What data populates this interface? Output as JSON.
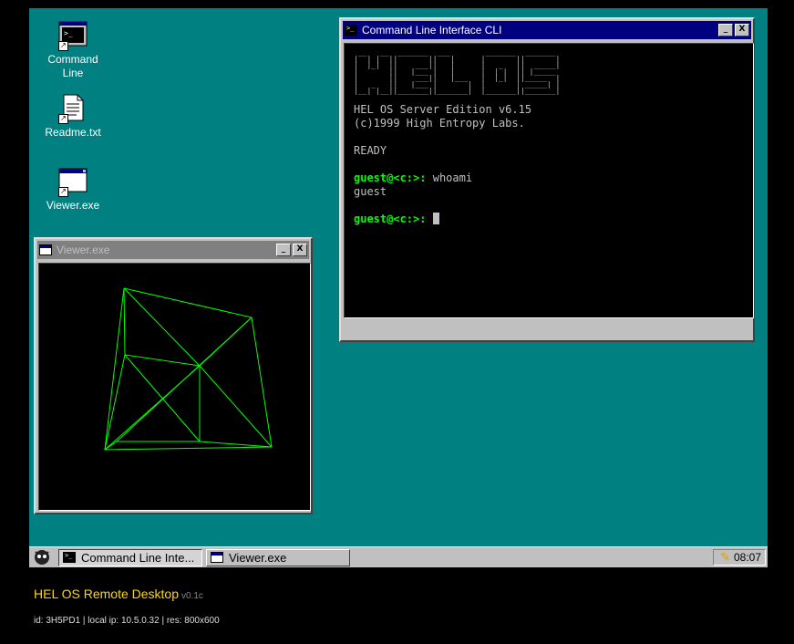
{
  "desktop": {
    "icons": [
      {
        "label": "Command\nLine",
        "icon": "terminal-icon"
      },
      {
        "label": "Readme.txt",
        "icon": "document-icon"
      },
      {
        "label": "Viewer.exe",
        "icon": "window-icon"
      }
    ],
    "background_color": "#008080"
  },
  "cli_window": {
    "title": "Command Line Interface CLI",
    "ascii_banner": " __   __  _______  ___        _______  _______ \n|  | |  ||       ||   |      |       ||       |\n|  |_|  ||    ___||   |      |   _   ||  _____|\n|       ||   |___ |   |      |  | |  || |_____ \n|       ||    ___||   |___   |  |_|  ||_____  |\n|   _   ||   |___ |       |  |       | _____| |\n|__| |__||_______||_______|  |_______||_______|",
    "lines": [
      "HEL OS Server Edition v6.15",
      "(c)1999 High Entropy Labs.",
      "",
      "READY"
    ],
    "prompt": "guest@<c:>:",
    "command": "whoami",
    "output": "guest",
    "prompt2": "guest@<c:>:",
    "minimize": "_",
    "close": "X"
  },
  "viewer_window": {
    "title": "Viewer.exe",
    "minimize": "_",
    "close": "X",
    "line_color": "#00ff00"
  },
  "taskbar": {
    "tasks": [
      {
        "label": "Command Line Inte..."
      },
      {
        "label": "Viewer.exe"
      }
    ],
    "clock": "08:07"
  },
  "footer": {
    "title": "HEL OS Remote Desktop",
    "version": "v0.1c",
    "info": "id: 3H5PD1 | local ip: 10.5.0.32 | res: 800x600"
  }
}
